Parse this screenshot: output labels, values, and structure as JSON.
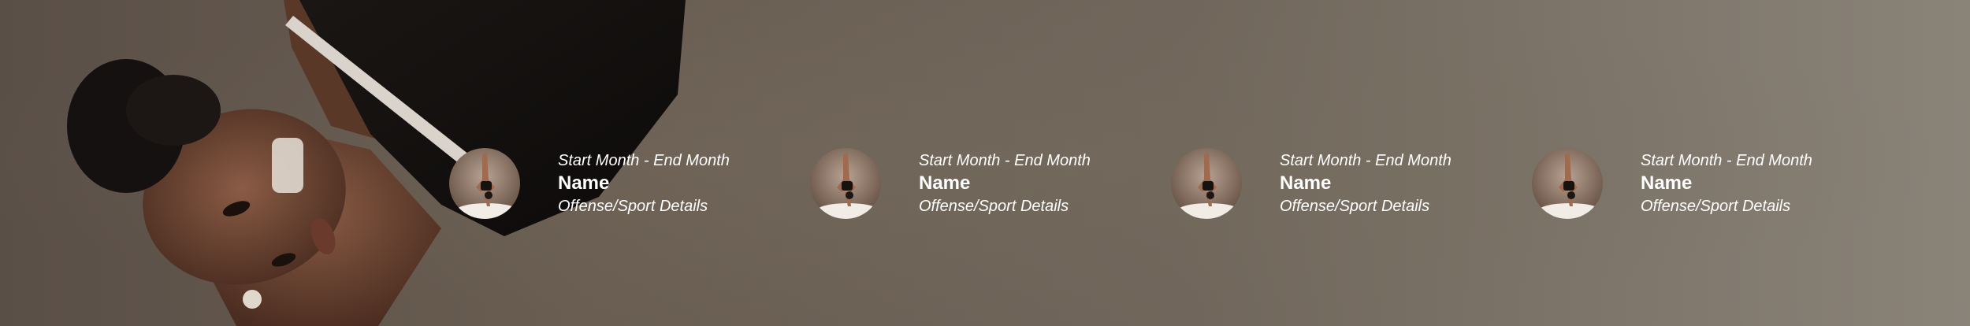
{
  "background": {
    "accent": "#6a5e52",
    "hero_image": "woman-in-black-top-photo"
  },
  "entries": [
    {
      "dates": "Start Month - End Month",
      "name": "Name",
      "details": "Offense/Sport Details",
      "avatar": "handstand-dancer-photo"
    },
    {
      "dates": "Start Month - End Month",
      "name": "Name",
      "details": "Offense/Sport Details",
      "avatar": "handstand-dancer-photo"
    },
    {
      "dates": "Start Month - End Month",
      "name": "Name",
      "details": "Offense/Sport Details",
      "avatar": "handstand-dancer-photo"
    },
    {
      "dates": "Start Month - End Month",
      "name": "Name",
      "details": "Offense/Sport Details",
      "avatar": "handstand-dancer-photo"
    }
  ]
}
